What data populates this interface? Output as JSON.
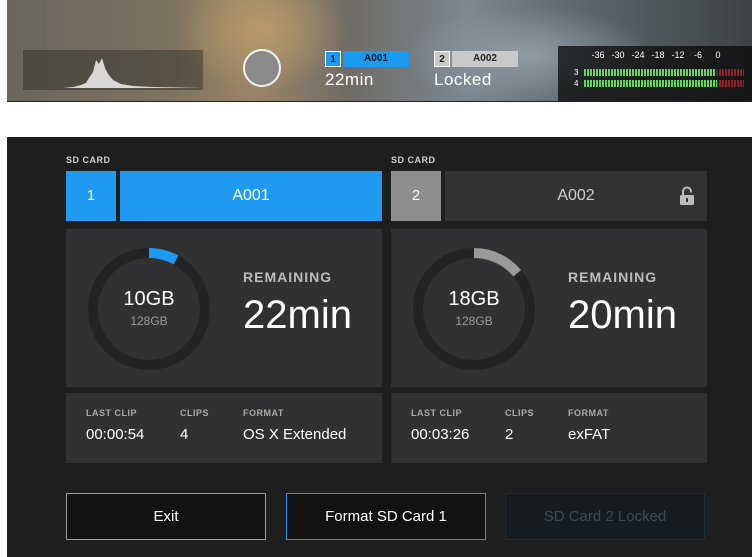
{
  "strip": {
    "slot1": {
      "num": "1",
      "name": "A001",
      "status": "22min"
    },
    "slot2": {
      "num": "2",
      "name": "A002",
      "status": "Locked"
    },
    "meter_scale": [
      "-36",
      "-30",
      "-24",
      "-18",
      "-12",
      "-6",
      "0"
    ],
    "channels": [
      {
        "label": "3",
        "level": 0.82
      },
      {
        "label": "4",
        "level": 0.83
      }
    ]
  },
  "cards": [
    {
      "section_label": "SD CARD",
      "slot_number": "1",
      "clip_name": "A001",
      "used": "10GB",
      "capacity": "128GB",
      "used_fraction": 0.08,
      "remaining_label": "REMAINING",
      "remaining": "22min",
      "last_clip_label": "LAST CLIP",
      "last_clip": "00:00:54",
      "clips_label": "CLIPS",
      "clips": "4",
      "format_label": "FORMAT",
      "format": "OS X Extended",
      "locked": false
    },
    {
      "section_label": "SD CARD",
      "slot_number": "2",
      "clip_name": "A002",
      "used": "18GB",
      "capacity": "128GB",
      "used_fraction": 0.14,
      "remaining_label": "REMAINING",
      "remaining": "20min",
      "last_clip_label": "LAST CLIP",
      "last_clip": "00:03:26",
      "clips_label": "CLIPS",
      "clips": "2",
      "format_label": "FORMAT",
      "format": "exFAT",
      "locked": true
    }
  ],
  "buttons": {
    "exit": "Exit",
    "format_card1": "Format SD Card 1",
    "card2_locked": "SD Card 2 Locked"
  },
  "colors": {
    "accent": "#1e9bf0",
    "panel_bg": "#1e1e1f",
    "tile_bg": "#313133",
    "ring_track": "#232325",
    "ring_used_card1": "#1e9bf0",
    "ring_used_card2": "#9a9a9a"
  },
  "icons": {
    "record": "record-button-icon",
    "lock": "padlock-icon",
    "histogram": "histogram-icon",
    "audio_meter": "audio-meter-icon"
  }
}
